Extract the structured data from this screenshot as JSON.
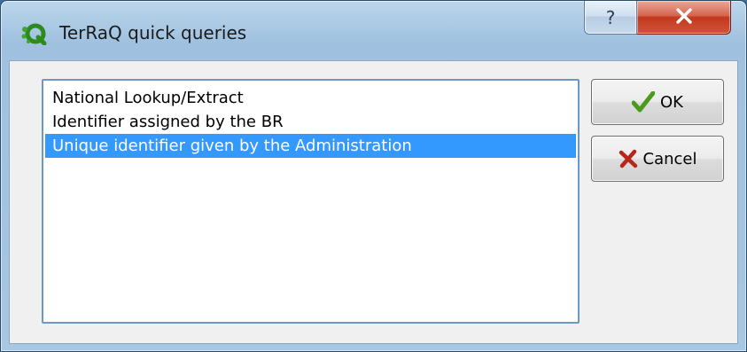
{
  "window": {
    "title": "TerRaQ quick queries",
    "help_label": "?",
    "app_icon": "terraq-logo-icon",
    "close_icon": "close-x-icon"
  },
  "queries": {
    "items": [
      {
        "label": "National Lookup/Extract",
        "selected": false
      },
      {
        "label": "Identifier assigned by the BR",
        "selected": false
      },
      {
        "label": "Unique identifier given by the Administration",
        "selected": true
      }
    ]
  },
  "buttons": {
    "ok_label": "OK",
    "ok_icon": "checkmark-icon",
    "cancel_label": "Cancel",
    "cancel_icon": "cross-icon"
  },
  "colors": {
    "selection": "#3399ff",
    "ok_check": "#4a9b1c",
    "cancel_cross": "#b8251a",
    "close_button": "#c2381d"
  }
}
